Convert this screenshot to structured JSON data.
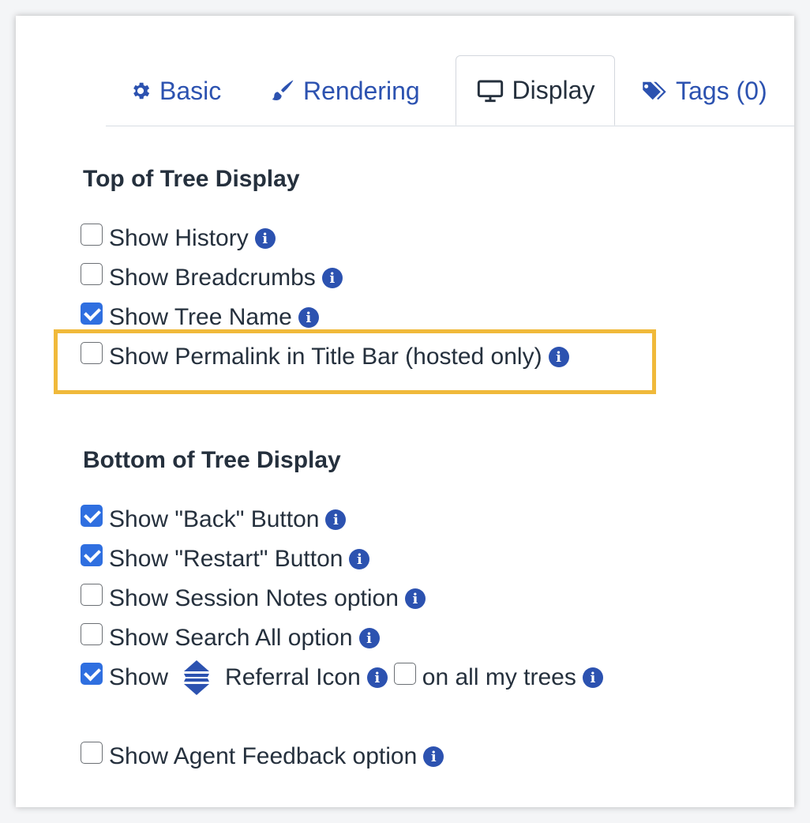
{
  "tabs": [
    {
      "label": "Basic",
      "icon": "gear-icon"
    },
    {
      "label": "Rendering",
      "icon": "paintbrush-icon"
    },
    {
      "label": "Display",
      "icon": "monitor-icon",
      "active": true
    },
    {
      "label": "Tags (0)",
      "icon": "tags-icon"
    }
  ],
  "top_section": {
    "title": "Top of Tree Display",
    "options": [
      {
        "label": "Show History",
        "checked": false
      },
      {
        "label": "Show Breadcrumbs",
        "checked": false
      },
      {
        "label": "Show Tree Name",
        "checked": true
      },
      {
        "label": "Show Permalink in Title Bar (hosted only)",
        "checked": false,
        "highlighted": true
      }
    ]
  },
  "bottom_section": {
    "title": "Bottom of Tree Display",
    "options": [
      {
        "label": "Show \"Back\" Button",
        "checked": true
      },
      {
        "label": "Show \"Restart\" Button",
        "checked": true
      },
      {
        "label": "Show Session Notes option",
        "checked": false
      },
      {
        "label": "Show Search All option",
        "checked": false
      }
    ],
    "referral": {
      "prefix": "Show",
      "suffix": "Referral Icon",
      "checked": true,
      "all_trees_label": "on all my trees",
      "all_trees_checked": false
    },
    "agent_feedback": {
      "label": "Show Agent Feedback option",
      "checked": false
    }
  },
  "info_glyph": "i",
  "colors": {
    "accent": "#2c52b0",
    "checkbox": "#2f6fe0",
    "highlight": "#f0b93a",
    "text": "#25303d"
  }
}
